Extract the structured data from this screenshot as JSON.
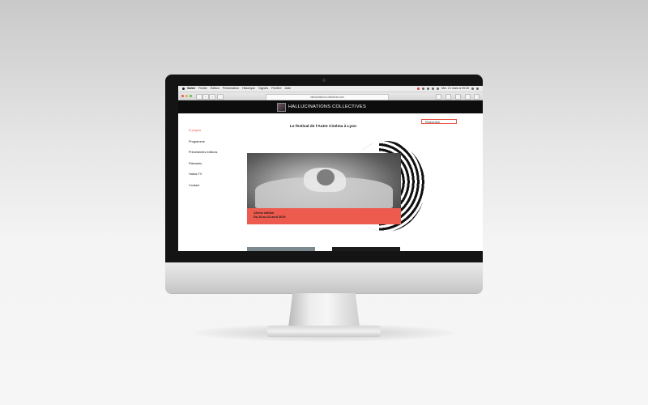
{
  "menubar": {
    "app": "Safari",
    "items": [
      "Fichier",
      "Édition",
      "Présentation",
      "Historique",
      "Signets",
      "Fenêtre",
      "Aide"
    ],
    "clock": "Mer. 21 mars à 09:26"
  },
  "browser": {
    "url": "hallucinations-collectives.com"
  },
  "site": {
    "title": "HALLUCINATIONS COLLECTIVES",
    "tagline": "Le festival de l'Autre Cinéma à Lyon",
    "search_label": "Rechercher",
    "nav": [
      {
        "label": "À propos",
        "active": true
      },
      {
        "label": "Programme",
        "active": false
      },
      {
        "label": "Précédentes éditions",
        "active": false
      },
      {
        "label": "Palmarès",
        "active": false
      },
      {
        "label": "Hallus TV",
        "active": false
      },
      {
        "label": "Contact",
        "active": false
      }
    ],
    "hero": {
      "edition": "12ème édition",
      "dates": "Du 16 au 22 avril 2019"
    }
  },
  "colors": {
    "accent": "#ec5b4e",
    "header_bg": "#0d0d0d"
  }
}
